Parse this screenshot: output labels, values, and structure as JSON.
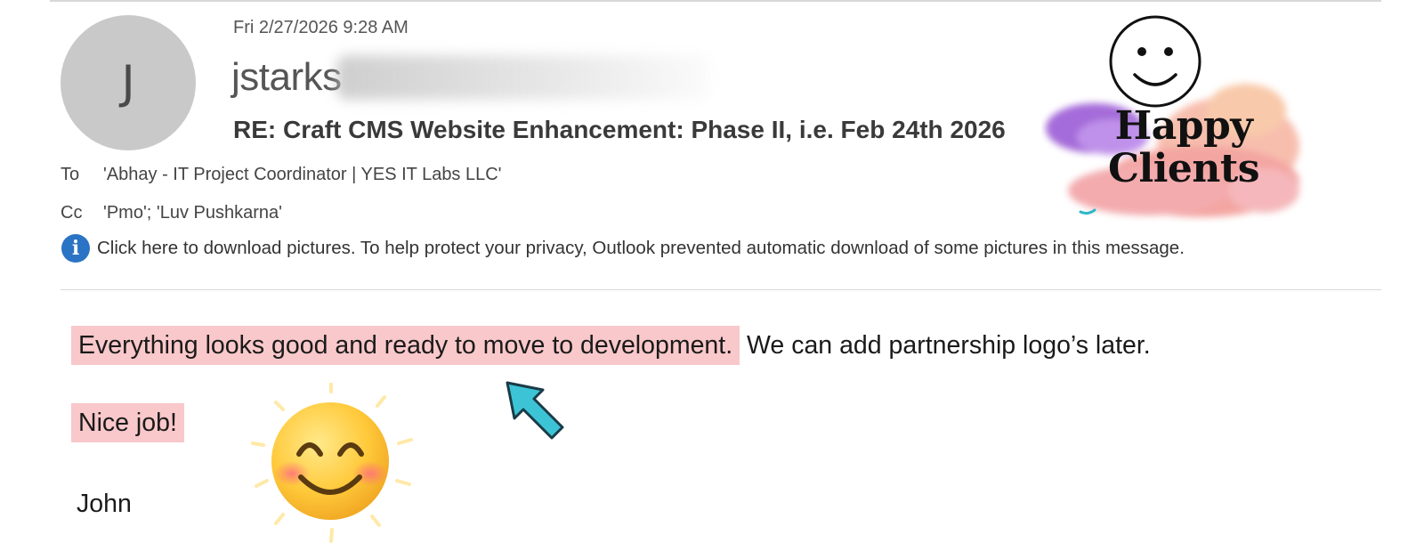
{
  "email": {
    "avatar_initial": "J",
    "date": "Fri 2/27/2026 9:28 AM",
    "sender_visible": "jstarks",
    "subject": "RE: Craft CMS Website Enhancement: Phase II, i.e. Feb 24th 2026",
    "to_label": "To",
    "to_value": "'Abhay - IT Project Coordinator | YES IT Labs LLC'",
    "cc_label": "Cc",
    "cc_value": "'Pmo'; 'Luv Pushkarna'",
    "info_text": "Click here to download pictures. To help protect your privacy, Outlook prevented automatic download of some pictures in this message."
  },
  "body": {
    "highlighted_sentence": "Everything looks good and ready to move to development.",
    "rest_sentence": "We can add partnership logo’s later.",
    "nice_job": "Nice job!",
    "signature": "John"
  },
  "badge": {
    "line1": "Happy",
    "line2": "Clients"
  },
  "icons": {
    "info": "info-icon",
    "smiley": "smiley-face-icon",
    "emoji": "blushing-smile-emoji-icon",
    "arrow": "pointer-arrow-icon"
  },
  "colors": {
    "highlight": "#f9c8ca",
    "info_blue": "#2b73c4",
    "arrow_teal": "#3cc4d6",
    "avatar_gray": "#c9c9c9"
  }
}
